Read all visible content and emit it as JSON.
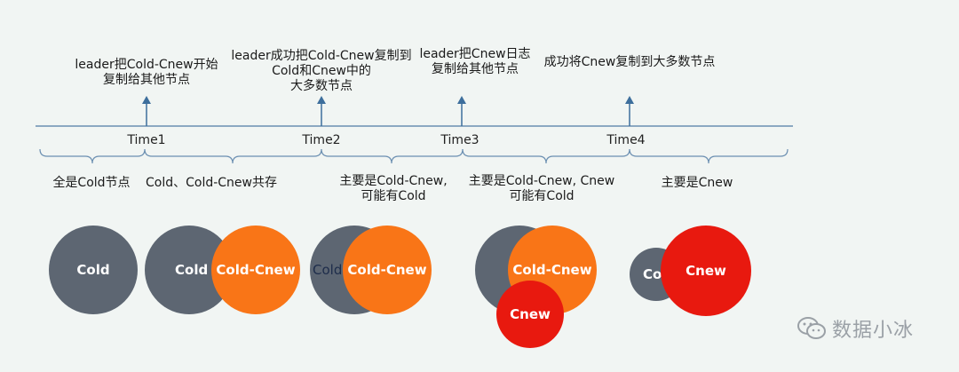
{
  "events": [
    {
      "label_lines": [
        "leader把Cold-Cnew开始",
        "复制给其他节点"
      ]
    },
    {
      "label_lines": [
        "leader成功把Cold-Cnew复制到",
        "Cold和Cnew中的",
        "大多数节点"
      ]
    },
    {
      "label_lines": [
        "leader把Cnew日志",
        "复制给其他节点"
      ]
    },
    {
      "label_lines": [
        "成功将Cnew复制到大多数节点"
      ]
    }
  ],
  "ticks": [
    "Time1",
    "Time2",
    "Time3",
    "Time4"
  ],
  "spans": [
    {
      "label_lines": [
        "全是Cold节点"
      ]
    },
    {
      "label_lines": [
        "Cold、Cold-Cnew共存"
      ]
    },
    {
      "label_lines": [
        "主要是Cold-Cnew,",
        "可能有Cold"
      ]
    },
    {
      "label_lines": [
        "主要是Cold-Cnew, Cnew",
        "可能有Cold"
      ]
    },
    {
      "label_lines": [
        "主要是Cnew"
      ]
    }
  ],
  "circles": {
    "g1": {
      "cold": "Cold"
    },
    "g2": {
      "cold": "Cold",
      "mid": "Cold-Cnew"
    },
    "g3": {
      "cold": "Cold",
      "mid": "Cold-Cnew"
    },
    "g4": {
      "mid": "Cold-Cnew",
      "new": "Cnew"
    },
    "g5": {
      "cold": "Col",
      "new": "Cnew"
    }
  },
  "colors": {
    "cold": "#5d6672",
    "cold_cnew": "#f97517",
    "cnew": "#e8190f",
    "axis": "#6b8fb1"
  },
  "watermark": {
    "text": "数据小冰",
    "icon": "wechat-icon"
  }
}
